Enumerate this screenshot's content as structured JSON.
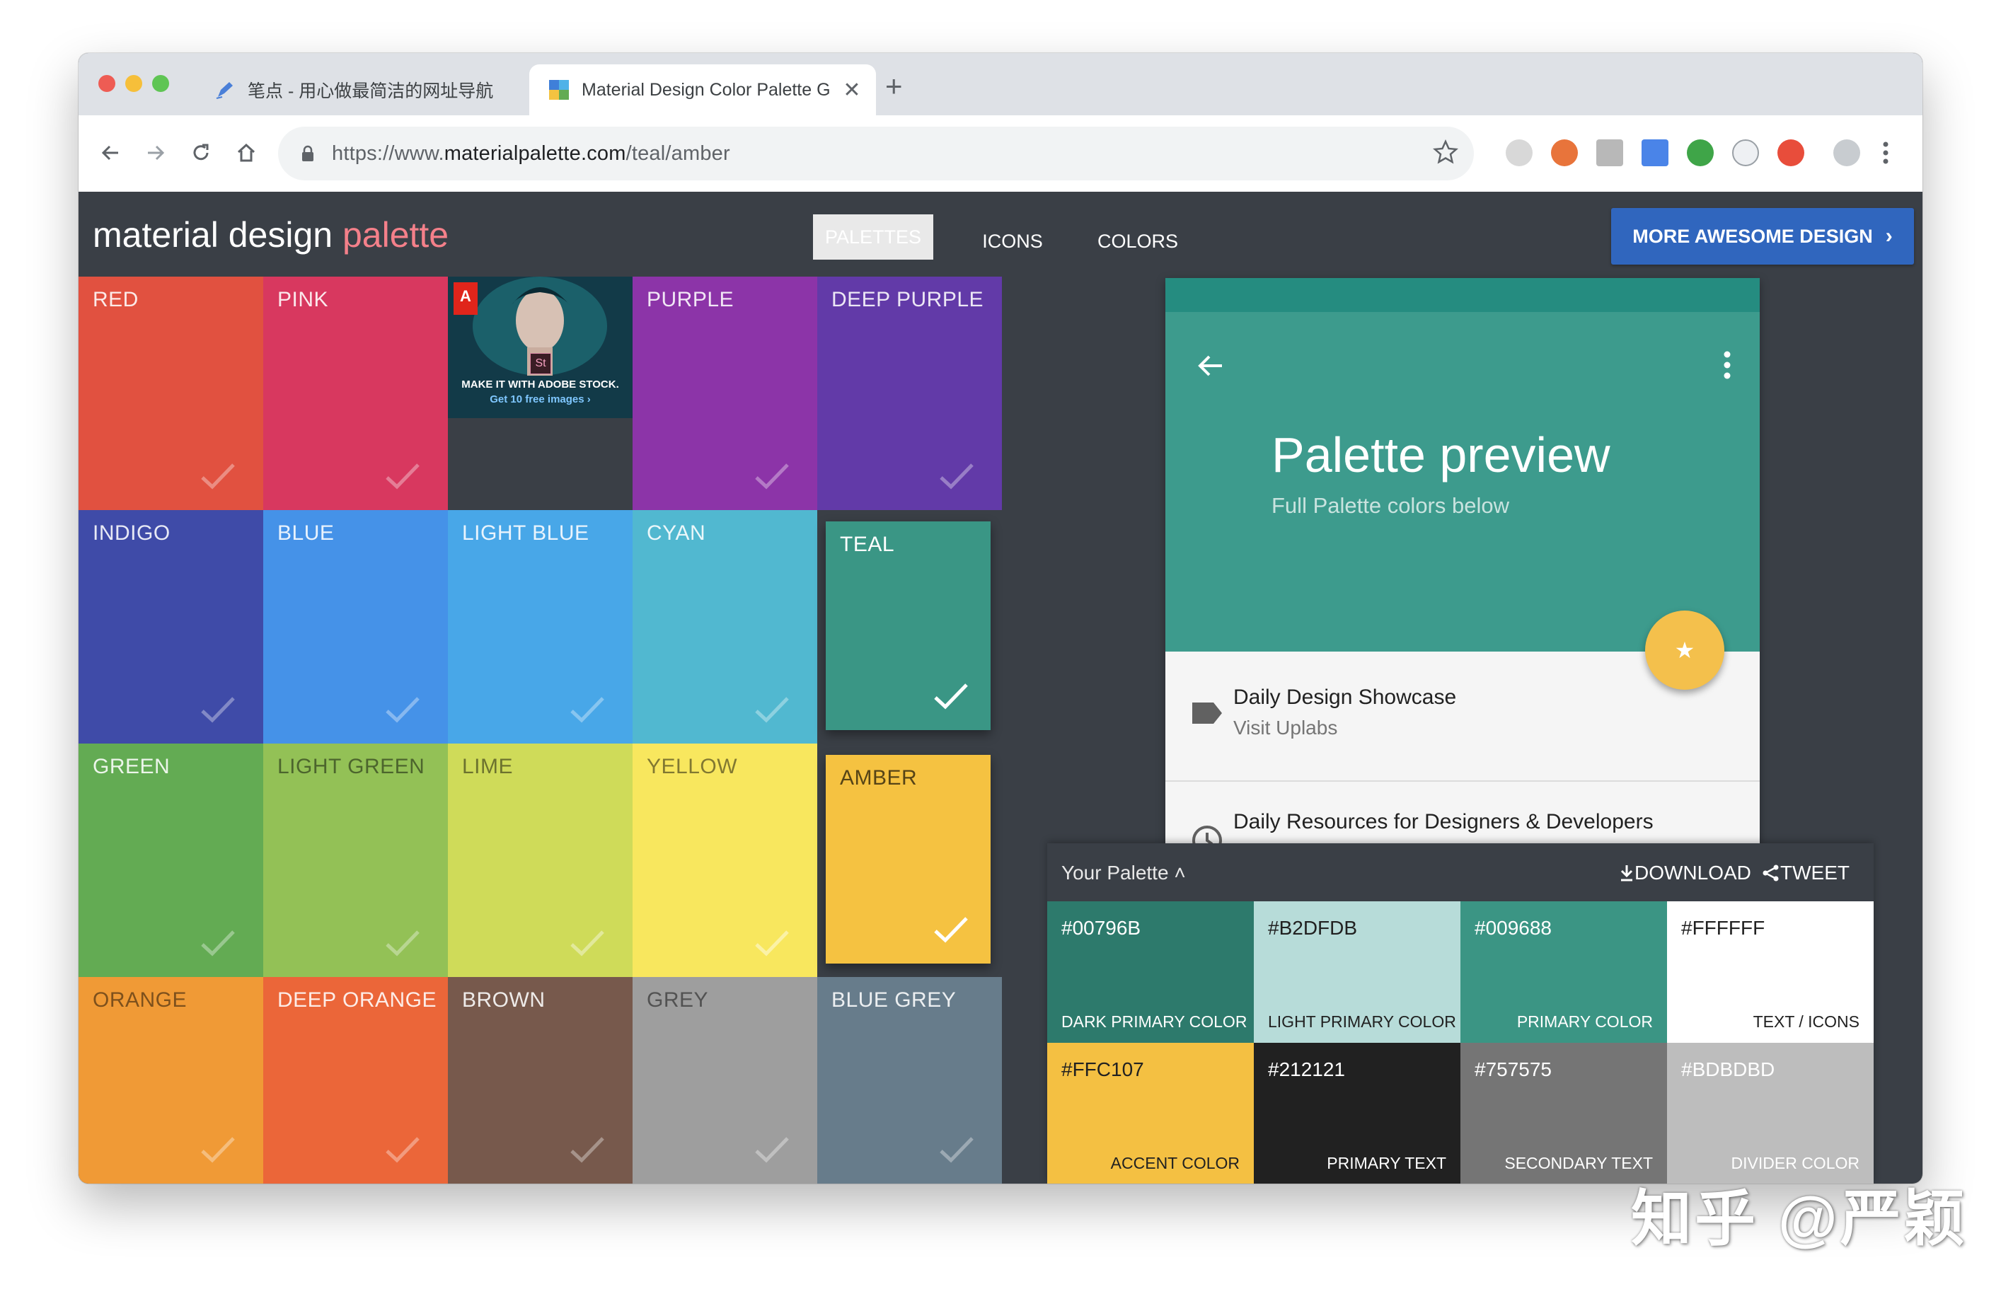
{
  "browser": {
    "tabs": [
      {
        "title": "笔点 - 用心做最简洁的网址导航",
        "active": false
      },
      {
        "title": "Material Design Color Palette G",
        "active": true
      }
    ],
    "url_prefix": "https://www.",
    "url_domain": "materialpalette.com",
    "url_path": "/teal/amber",
    "traffic_lights": [
      "#ee5c54",
      "#f6bf3a",
      "#5fc554"
    ]
  },
  "site": {
    "logo_main": "material design",
    "logo_accent": "palette",
    "nav": [
      "PALETTES",
      "ICONS",
      "COLORS"
    ],
    "nav_active": "PALETTES",
    "more_button": "MORE AWESOME DESIGN"
  },
  "grid": {
    "tiles": [
      {
        "label": "RED",
        "color": "#e15140"
      },
      {
        "label": "PINK",
        "color": "#d8385f"
      },
      {
        "label": "PURPLE",
        "color": "#8c34a8"
      },
      {
        "label": "DEEP PURPLE",
        "color": "#623aa8"
      },
      {
        "label": "INDIGO",
        "color": "#3f4ba8"
      },
      {
        "label": "BLUE",
        "color": "#4592e8"
      },
      {
        "label": "LIGHT BLUE",
        "color": "#48a7e8"
      },
      {
        "label": "CYAN",
        "color": "#51b8d0"
      },
      {
        "label": "TEAL",
        "color": "#3a9685"
      },
      {
        "label": "GREEN",
        "color": "#63ab53"
      },
      {
        "label": "LIGHT GREEN",
        "color": "#93c156"
      },
      {
        "label": "LIME",
        "color": "#cfdb59"
      },
      {
        "label": "YELLOW",
        "color": "#f8e75e"
      },
      {
        "label": "AMBER",
        "color": "#f5c241"
      },
      {
        "label": "ORANGE",
        "color": "#f09a36"
      },
      {
        "label": "DEEP ORANGE",
        "color": "#eb6639"
      },
      {
        "label": "BROWN",
        "color": "#77594c"
      },
      {
        "label": "GREY",
        "color": "#9e9e9e"
      },
      {
        "label": "BLUE GREY",
        "color": "#677c8b"
      }
    ],
    "selected": [
      "TEAL",
      "AMBER"
    ],
    "ad": {
      "line1": "MAKE IT WITH ADOBE STOCK.",
      "line2": "Get 10 free images ›",
      "badge": "St"
    }
  },
  "preview": {
    "title": "Palette preview",
    "subtitle": "Full Palette colors below",
    "items": [
      {
        "primary": "Daily Design Showcase",
        "secondary": "Visit Uplabs"
      },
      {
        "primary": "Daily Resources for Designers & Developers",
        "secondary": ""
      }
    ]
  },
  "palette": {
    "title": "Your Palette",
    "download": "DOWNLOAD",
    "tweet": "TWEET",
    "swatches": [
      {
        "hex": "#00796B",
        "role": "DARK PRIMARY COLOR",
        "bg": "#2d7a6c",
        "fg": "#ffffff"
      },
      {
        "hex": "#B2DFDB",
        "role": "LIGHT PRIMARY COLOR",
        "bg": "#b7dcd9",
        "fg": "#212121"
      },
      {
        "hex": "#009688",
        "role": "PRIMARY COLOR",
        "bg": "#3b9584",
        "fg": "#ffffff"
      },
      {
        "hex": "#FFFFFF",
        "role": "TEXT / ICONS",
        "bg": "#ffffff",
        "fg": "#212121"
      },
      {
        "hex": "#FFC107",
        "role": "ACCENT COLOR",
        "bg": "#f4c042",
        "fg": "#212121"
      },
      {
        "hex": "#212121",
        "role": "PRIMARY TEXT",
        "bg": "#212121",
        "fg": "#ffffff"
      },
      {
        "hex": "#757575",
        "role": "SECONDARY TEXT",
        "bg": "#757575",
        "fg": "#ffffff"
      },
      {
        "hex": "#BDBDBD",
        "role": "DIVIDER COLOR",
        "bg": "#bdbdbd",
        "fg": "#ffffff"
      }
    ]
  },
  "watermark": "知乎 @严颖"
}
